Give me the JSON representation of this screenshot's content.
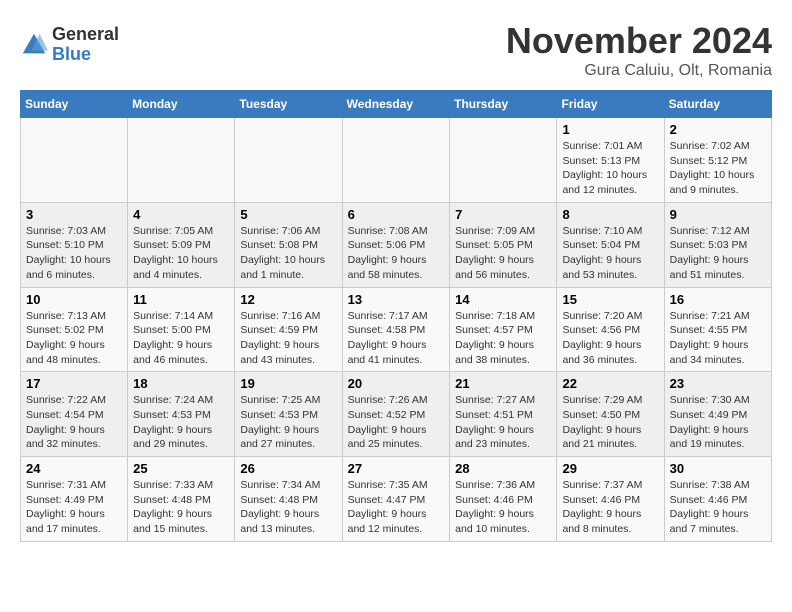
{
  "logo": {
    "general": "General",
    "blue": "Blue"
  },
  "title": "November 2024",
  "subtitle": "Gura Caluiu, Olt, Romania",
  "headers": [
    "Sunday",
    "Monday",
    "Tuesday",
    "Wednesday",
    "Thursday",
    "Friday",
    "Saturday"
  ],
  "rows": [
    [
      {
        "day": "",
        "info": ""
      },
      {
        "day": "",
        "info": ""
      },
      {
        "day": "",
        "info": ""
      },
      {
        "day": "",
        "info": ""
      },
      {
        "day": "",
        "info": ""
      },
      {
        "day": "1",
        "info": "Sunrise: 7:01 AM\nSunset: 5:13 PM\nDaylight: 10 hours and 12 minutes."
      },
      {
        "day": "2",
        "info": "Sunrise: 7:02 AM\nSunset: 5:12 PM\nDaylight: 10 hours and 9 minutes."
      }
    ],
    [
      {
        "day": "3",
        "info": "Sunrise: 7:03 AM\nSunset: 5:10 PM\nDaylight: 10 hours and 6 minutes."
      },
      {
        "day": "4",
        "info": "Sunrise: 7:05 AM\nSunset: 5:09 PM\nDaylight: 10 hours and 4 minutes."
      },
      {
        "day": "5",
        "info": "Sunrise: 7:06 AM\nSunset: 5:08 PM\nDaylight: 10 hours and 1 minute."
      },
      {
        "day": "6",
        "info": "Sunrise: 7:08 AM\nSunset: 5:06 PM\nDaylight: 9 hours and 58 minutes."
      },
      {
        "day": "7",
        "info": "Sunrise: 7:09 AM\nSunset: 5:05 PM\nDaylight: 9 hours and 56 minutes."
      },
      {
        "day": "8",
        "info": "Sunrise: 7:10 AM\nSunset: 5:04 PM\nDaylight: 9 hours and 53 minutes."
      },
      {
        "day": "9",
        "info": "Sunrise: 7:12 AM\nSunset: 5:03 PM\nDaylight: 9 hours and 51 minutes."
      }
    ],
    [
      {
        "day": "10",
        "info": "Sunrise: 7:13 AM\nSunset: 5:02 PM\nDaylight: 9 hours and 48 minutes."
      },
      {
        "day": "11",
        "info": "Sunrise: 7:14 AM\nSunset: 5:00 PM\nDaylight: 9 hours and 46 minutes."
      },
      {
        "day": "12",
        "info": "Sunrise: 7:16 AM\nSunset: 4:59 PM\nDaylight: 9 hours and 43 minutes."
      },
      {
        "day": "13",
        "info": "Sunrise: 7:17 AM\nSunset: 4:58 PM\nDaylight: 9 hours and 41 minutes."
      },
      {
        "day": "14",
        "info": "Sunrise: 7:18 AM\nSunset: 4:57 PM\nDaylight: 9 hours and 38 minutes."
      },
      {
        "day": "15",
        "info": "Sunrise: 7:20 AM\nSunset: 4:56 PM\nDaylight: 9 hours and 36 minutes."
      },
      {
        "day": "16",
        "info": "Sunrise: 7:21 AM\nSunset: 4:55 PM\nDaylight: 9 hours and 34 minutes."
      }
    ],
    [
      {
        "day": "17",
        "info": "Sunrise: 7:22 AM\nSunset: 4:54 PM\nDaylight: 9 hours and 32 minutes."
      },
      {
        "day": "18",
        "info": "Sunrise: 7:24 AM\nSunset: 4:53 PM\nDaylight: 9 hours and 29 minutes."
      },
      {
        "day": "19",
        "info": "Sunrise: 7:25 AM\nSunset: 4:53 PM\nDaylight: 9 hours and 27 minutes."
      },
      {
        "day": "20",
        "info": "Sunrise: 7:26 AM\nSunset: 4:52 PM\nDaylight: 9 hours and 25 minutes."
      },
      {
        "day": "21",
        "info": "Sunrise: 7:27 AM\nSunset: 4:51 PM\nDaylight: 9 hours and 23 minutes."
      },
      {
        "day": "22",
        "info": "Sunrise: 7:29 AM\nSunset: 4:50 PM\nDaylight: 9 hours and 21 minutes."
      },
      {
        "day": "23",
        "info": "Sunrise: 7:30 AM\nSunset: 4:49 PM\nDaylight: 9 hours and 19 minutes."
      }
    ],
    [
      {
        "day": "24",
        "info": "Sunrise: 7:31 AM\nSunset: 4:49 PM\nDaylight: 9 hours and 17 minutes."
      },
      {
        "day": "25",
        "info": "Sunrise: 7:33 AM\nSunset: 4:48 PM\nDaylight: 9 hours and 15 minutes."
      },
      {
        "day": "26",
        "info": "Sunrise: 7:34 AM\nSunset: 4:48 PM\nDaylight: 9 hours and 13 minutes."
      },
      {
        "day": "27",
        "info": "Sunrise: 7:35 AM\nSunset: 4:47 PM\nDaylight: 9 hours and 12 minutes."
      },
      {
        "day": "28",
        "info": "Sunrise: 7:36 AM\nSunset: 4:46 PM\nDaylight: 9 hours and 10 minutes."
      },
      {
        "day": "29",
        "info": "Sunrise: 7:37 AM\nSunset: 4:46 PM\nDaylight: 9 hours and 8 minutes."
      },
      {
        "day": "30",
        "info": "Sunrise: 7:38 AM\nSunset: 4:46 PM\nDaylight: 9 hours and 7 minutes."
      }
    ]
  ]
}
